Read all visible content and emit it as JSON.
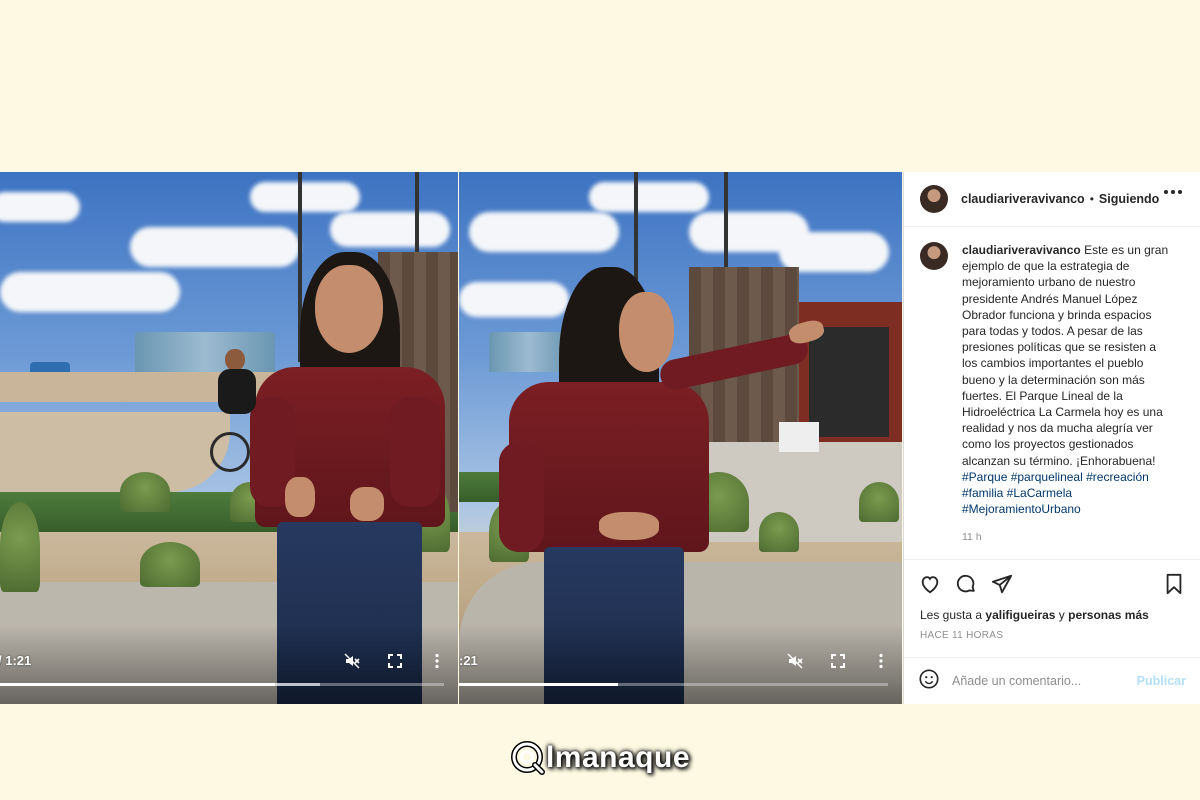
{
  "videos": [
    {
      "time": "/ 1:21",
      "progress_fraction": 0.62,
      "buffered_fraction": 0.72
    },
    {
      "time": ":21",
      "progress_fraction": 0.37,
      "buffered_fraction": 0.37
    }
  ],
  "post": {
    "username": "claudiariveravivanco",
    "separator": "•",
    "follow_status": "Siguiendo",
    "caption_username": "claudiariveravivanco",
    "caption_text": "Este es un gran ejemplo de que la estrategia de mejoramiento urbano de nuestro presidente Andrés Manuel López Obrador funciona y brinda espacios para todas y todos. A pesar de las presiones políticas que se resisten a los cambios importantes el pueblo bueno y la determinación son más fuertes. El Parque Lineal de la Hidroeléctrica La Carmela hoy es una realidad y nos da mucha alegría ver como los proyectos gestionados alcanzan su término. ¡Enhorabuena!",
    "hashtags": "#Parque #parquelineal #recreación #familia #LaCarmela #MejoramientoUrbano",
    "time_ago": "11 h",
    "likes_prefix": "Les gusta a",
    "likes_user": "yalifigueiras",
    "likes_and": "y",
    "likes_more": "personas más",
    "posted": "HACE 11 HORAS",
    "comment_placeholder": "Añade un comentario...",
    "publish_label": "Publicar",
    "icons": [
      "heart-icon",
      "comment-icon",
      "share-icon",
      "bookmark-icon",
      "emoji-icon",
      "more-options-icon",
      "mute-icon",
      "fullscreen-icon"
    ]
  },
  "watermark": {
    "text": "lmanaque"
  },
  "colors": {
    "background": "#fdf9e3",
    "link": "#00376b",
    "publish": "#b2dffc",
    "shirt": "#7b1f24"
  }
}
